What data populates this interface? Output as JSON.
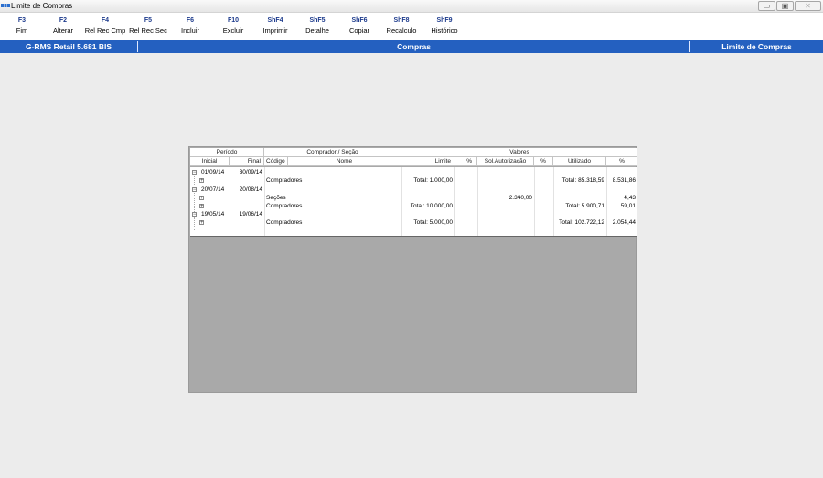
{
  "window": {
    "title": "Limite de Compras",
    "buttons": {
      "minimize": "▭",
      "restore": "▣",
      "close": "✕"
    }
  },
  "toolbar": {
    "keys": [
      {
        "key": "F3",
        "label": "Fim"
      },
      {
        "key": "F2",
        "label": "Alterar"
      },
      {
        "key": "F4",
        "label": "Rel Rec Cmp"
      },
      {
        "key": "F5",
        "label": "Rel Rec Sec"
      },
      {
        "key": "F6",
        "label": "Incluir"
      },
      {
        "key": "F10",
        "label": "Excluir"
      },
      {
        "key": "ShF4",
        "label": "Imprimir"
      },
      {
        "key": "ShF5",
        "label": "Detalhe"
      },
      {
        "key": "ShF6",
        "label": "Copiar"
      },
      {
        "key": "ShF8",
        "label": "Recalculo"
      },
      {
        "key": "ShF9",
        "label": "Histórico"
      }
    ]
  },
  "statusbar": {
    "app": "G-RMS Retail 5.681 BIS",
    "module": "Compras",
    "screen": "Limite de Compras"
  },
  "grid": {
    "groups": {
      "periodo": "Período",
      "comprador": "Comprador / Seção",
      "valores": "Valores"
    },
    "columns": {
      "inicial": "Inicial",
      "final": "Final",
      "codigo": "Código",
      "nome": "Nome",
      "limite": "Limite",
      "pct1": "%",
      "sol": "Sol.Autorização",
      "pct2": "%",
      "utilizado": "Utilizado",
      "pct3": "%"
    },
    "rows": [
      {
        "toggle": "−",
        "inicial": "01/09/14",
        "final": "30/09/14",
        "codigo": "",
        "limite": "",
        "sol": "",
        "utilizado": "",
        "pct3": ""
      },
      {
        "toggle": "+",
        "inicial": "",
        "final": "",
        "codigo": "Compradores",
        "limite": "Total: 1.000,00",
        "sol": "",
        "utilizado": "Total: 85.318,59",
        "pct3": "8.531,86"
      },
      {
        "toggle": "−",
        "inicial": "20/07/14",
        "final": "20/08/14",
        "codigo": "",
        "limite": "",
        "sol": "",
        "utilizado": "",
        "pct3": ""
      },
      {
        "toggle": "+",
        "inicial": "",
        "final": "",
        "codigo": "Seções",
        "limite": "",
        "sol": "2.340,00",
        "utilizado": "",
        "pct3": "4,43"
      },
      {
        "toggle": "+",
        "inicial": "",
        "final": "",
        "codigo": "Compradores",
        "limite": "Total: 10.000,00",
        "sol": "",
        "utilizado": "Total: 5.900,71",
        "pct3": "59,01"
      },
      {
        "toggle": "−",
        "inicial": "19/05/14",
        "final": "19/06/14",
        "codigo": "",
        "limite": "",
        "sol": "",
        "utilizado": "",
        "pct3": ""
      },
      {
        "toggle": "+",
        "inicial": "",
        "final": "",
        "codigo": "Compradores",
        "limite": "Total: 5.000,00",
        "sol": "",
        "utilizado": "Total: 102.722,12",
        "pct3": "2.054,44"
      }
    ]
  }
}
